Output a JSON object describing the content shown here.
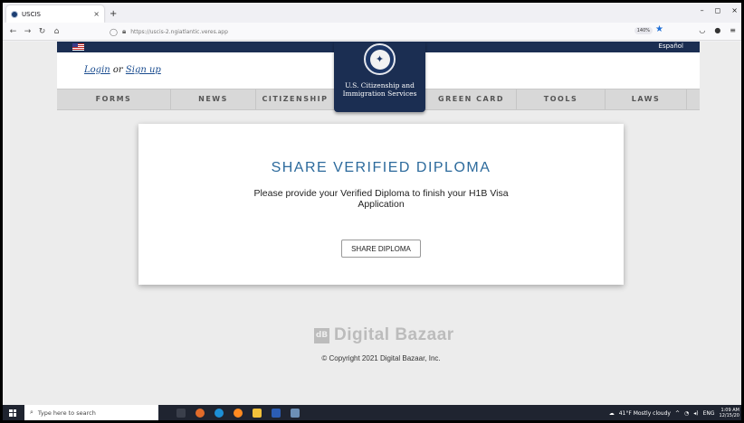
{
  "browser": {
    "tab_title": "USCIS",
    "tab_close": "×",
    "new_tab": "+",
    "url": "https://uscis-2.ngiatlantic.veres.app",
    "zoom": "140%",
    "window_controls": [
      "–",
      "◻",
      "×"
    ]
  },
  "header": {
    "language_link": "Español",
    "login": "Login",
    "or": "or",
    "signup": "Sign up",
    "agency_line1": "U.S. Citizenship and",
    "agency_line2": "Immigration Services"
  },
  "nav": {
    "items": [
      "FORMS",
      "NEWS",
      "CITIZENSHIP",
      "GREEN CARD",
      "TOOLS",
      "LAWS"
    ]
  },
  "card": {
    "title": "SHARE VERIFIED DIPLOMA",
    "message": "Please provide your Verified Diploma to finish your H1B Visa Application",
    "button": "SHARE DIPLOMA"
  },
  "footer": {
    "logo_mark": "dB",
    "logo_text": "Digital Bazaar",
    "copyright": "© Copyright 2021 Digital Bazaar, Inc."
  },
  "taskbar": {
    "search_placeholder": "Type here to search",
    "weather": "41°F  Mostly cloudy",
    "language": "ENG",
    "time": "1:09 AM",
    "date": "12/15/20"
  }
}
